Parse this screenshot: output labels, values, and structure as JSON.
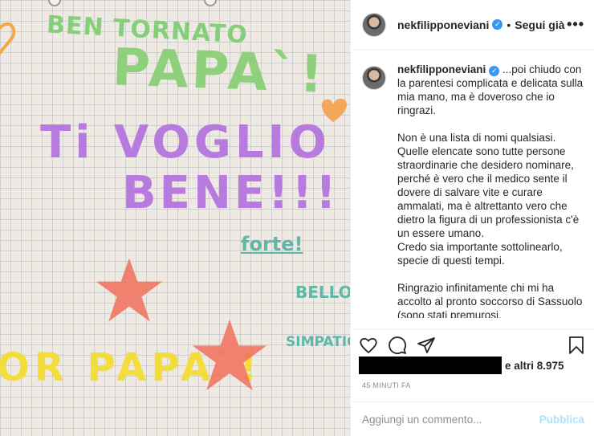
{
  "photo": {
    "texts": {
      "bentornato": "BEN TORNATO",
      "papa": "PAPA`!",
      "tivoglio": "Ti VOGLIO",
      "bene": "BENE!!!",
      "forte": "forte!",
      "bello": "BELLO",
      "simpatico": "SIMPATICO",
      "orpapa": "OR PAPA`!"
    }
  },
  "header": {
    "username": "nekfilipponeviani",
    "verified_icon": "verified-badge-icon",
    "separator": "•",
    "follow_label": "Segui già",
    "more_label": "•••"
  },
  "caption": {
    "username": "nekfilipponeviani",
    "paragraphs": [
      "...poi chiudo con la parentesi complicata e delicata sulla mia mano, ma è doveroso che io ringrazi.",
      "Non è una lista di nomi qualsiasi.\nQuelle elencate sono tutte persone straordinarie che desidero nominare, perché è vero che il medico sente il dovere di salvare vite e curare ammalati, ma è altrettanto vero che dietro la figura di un professionista c'è un essere umano.\nCredo sia importante sottolinearlo, specie di questi tempi.",
      "Ringrazio infinitamente chi mi ha accolto al pronto soccorso di Sassuolo (sono stati premurosi,"
    ]
  },
  "actions": {
    "icons": [
      "heart-icon",
      "comment-icon",
      "share-icon",
      "bookmark-icon"
    ]
  },
  "likes": {
    "text": "e altri 8.975"
  },
  "timestamp": "45 MINUTI FA",
  "comment": {
    "placeholder": "Aggiungi un commento...",
    "publish_label": "Pubblica"
  },
  "colors": {
    "accent_blue": "#3897f0",
    "publish_disabled": "#b2dffc",
    "muted_text": "#8e8e8e"
  }
}
